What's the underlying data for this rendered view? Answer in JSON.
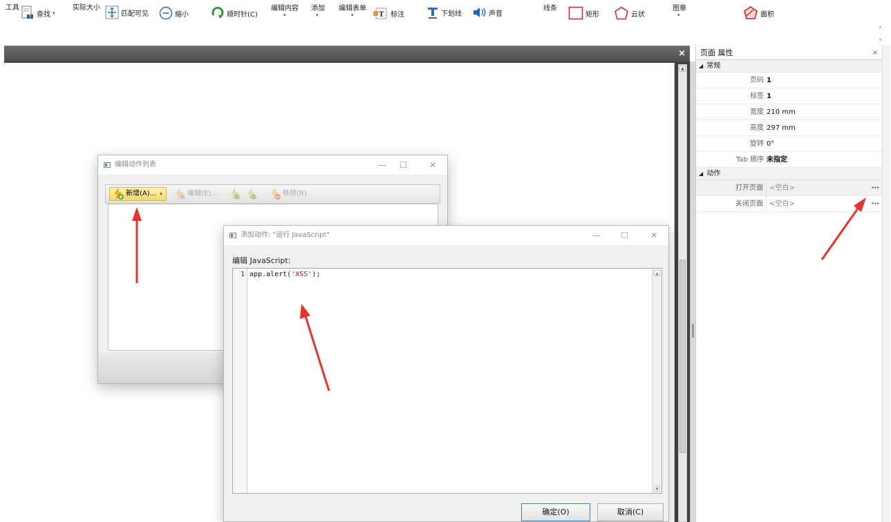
{
  "ribbon": {
    "tools_label": "工具",
    "find_label": "查找",
    "actual_size_label": "实际大小",
    "fit_visible_label": "匹配可见",
    "zoom_out_label": "缩小",
    "clockwise_label": "顺时针(C)",
    "edit_content_label": "编辑内容",
    "add_label": "添加",
    "edit_form_label": "编辑表单",
    "annotate_label": "标注",
    "underline_label": "下划线",
    "sound_label": "声音",
    "lines_label": "线条",
    "rectangle_label": "矩形",
    "cloud_label": "云状",
    "stamp_label": "图章",
    "area_label": "面积"
  },
  "properties": {
    "title": "页面 属性",
    "close": "×",
    "section_general": "常规",
    "rows": [
      {
        "key": "页码",
        "value": "1"
      },
      {
        "key": "标签",
        "value": "1"
      },
      {
        "key": "宽度",
        "value": "210 mm"
      },
      {
        "key": "高度",
        "value": "297 mm"
      },
      {
        "key": "旋转",
        "value": "0°"
      },
      {
        "key": "Tab 顺序",
        "value": "未指定"
      }
    ],
    "section_actions": "动作",
    "actions": [
      {
        "key": "打开页面",
        "value": "<空白>"
      },
      {
        "key": "关闭页面",
        "value": "<空白>"
      }
    ],
    "more_button": "···"
  },
  "doc_tab": {
    "close": "×"
  },
  "action_list_dialog": {
    "title": "编辑动作列表",
    "new_button": "新增(A)...",
    "edit_button": "编辑(E)...",
    "remove_button": "移除(R)"
  },
  "js_dialog": {
    "title": "添加动作: \"运行 JavaScript\"",
    "label": "编辑 JavaScript:",
    "line_number": "1",
    "code_prefix": "app.alert(",
    "code_string": "'XSS'",
    "code_suffix": ");",
    "ok_button": "确定(O)",
    "cancel_button": "取消(C)"
  },
  "window_controls": {
    "minimize": "—",
    "maximize": "☐",
    "close": "✕"
  },
  "colors": {
    "primary_button": "#f6d96b",
    "arrow": "#e8322b",
    "dark_bar": "#4f4f4f"
  }
}
